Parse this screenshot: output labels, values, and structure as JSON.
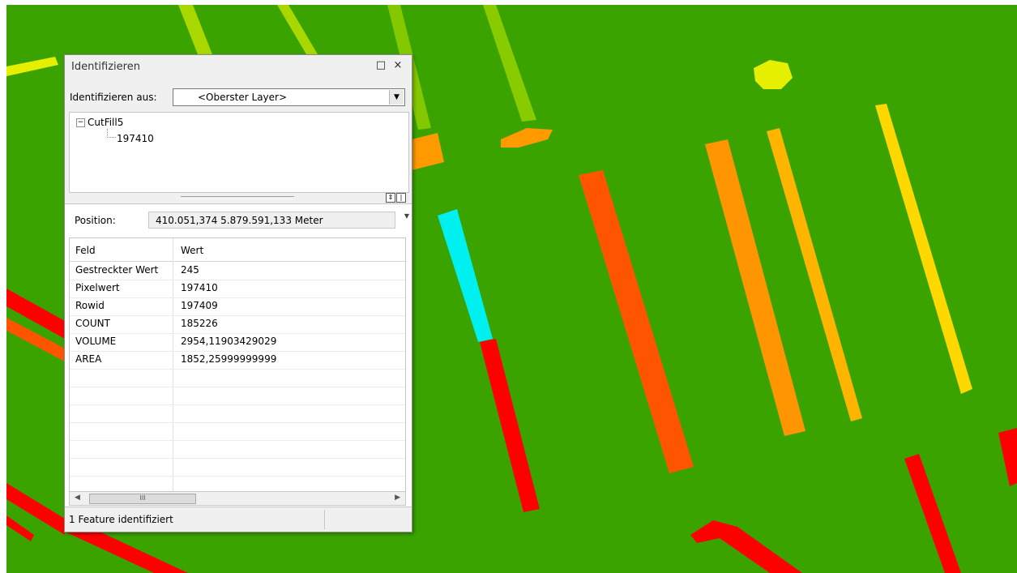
{
  "window": {
    "title": "Identifizieren",
    "maximize_glyph": "□",
    "close_glyph": "×"
  },
  "identify_from": {
    "label": "Identifizieren aus:",
    "value": "<Oberster Layer>"
  },
  "tree": {
    "layer": "CutFill5",
    "toggle": "−",
    "feature": "197410"
  },
  "position": {
    "label": "Position:",
    "value": "410.051,374  5.879.591,133 Meter"
  },
  "table": {
    "headers": [
      "Feld",
      "Wert"
    ],
    "rows": [
      {
        "field": "Gestreckter Wert",
        "value": "245"
      },
      {
        "field": "Pixelwert",
        "value": "197410"
      },
      {
        "field": "Rowid",
        "value": "197409"
      },
      {
        "field": "COUNT",
        "value": "185226"
      },
      {
        "field": "VOLUME",
        "value": "2954,11903429029"
      },
      {
        "field": "AREA",
        "value": "1852,25999999999"
      }
    ],
    "empty_rows": 7
  },
  "status": {
    "text": "1 Feature identifiziert"
  },
  "icons": [
    "maximize-icon",
    "close-icon",
    "dropdown-arrow-icon",
    "tree-collapse-icon",
    "splitter-collapse-icon",
    "splitter-pin-icon",
    "position-menu-icon",
    "scroll-left-icon",
    "scroll-right-icon"
  ],
  "colors": {
    "map_background": "#3aa300",
    "selected_feature": "#00f0f0",
    "cut_red": "#ff0000",
    "cut_orange_red": "#ff5500",
    "cut_orange": "#ff9500",
    "cut_yellow_orange": "#ffb400",
    "cut_yellow": "#ffd800",
    "fill_yellow_green": "#bfe000",
    "fill_light_green": "#84c800",
    "fill_green": "#9ad000"
  }
}
